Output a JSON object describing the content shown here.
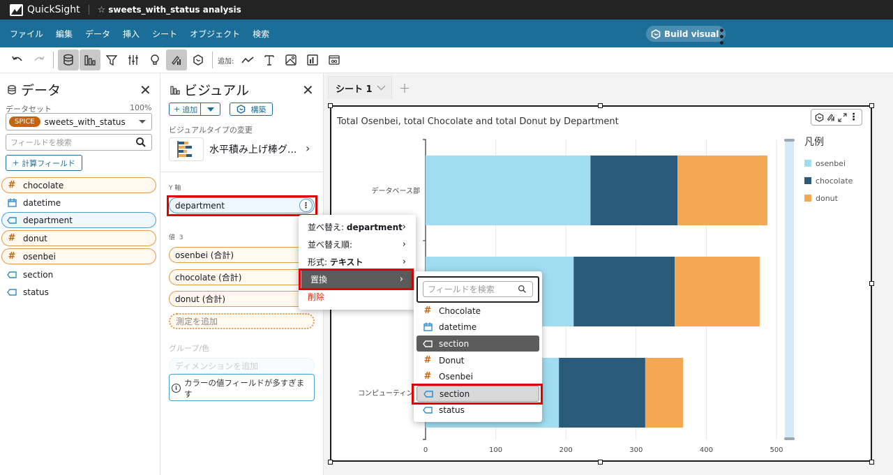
{
  "app": {
    "brand": "QuickSight",
    "analysis_title": "sweets_with_status analysis"
  },
  "menubar": {
    "items": [
      "ファイル",
      "編集",
      "データ",
      "挿入",
      "シート",
      "オブジェクト",
      "検索"
    ],
    "build_visual": "Build visual"
  },
  "toolbar": {
    "add_label": "追加:"
  },
  "data_panel": {
    "title": "データ",
    "dataset_label": "データセット",
    "dataset_percent": "100%",
    "spice_badge": "SPICE",
    "dataset_name": "sweets_with_status",
    "search_placeholder": "フィールドを検索",
    "calc_field_button": "計算フィールド",
    "fields": [
      {
        "name": "chocolate",
        "type": "measure"
      },
      {
        "name": "datetime",
        "type": "date"
      },
      {
        "name": "department",
        "type": "dimension",
        "selected": true
      },
      {
        "name": "donut",
        "type": "measure"
      },
      {
        "name": "osenbei",
        "type": "measure"
      },
      {
        "name": "section",
        "type": "dimension"
      },
      {
        "name": "status",
        "type": "dimension"
      }
    ]
  },
  "visual_panel": {
    "title": "ビジュアル",
    "add_button": "追加",
    "build_button": "構築",
    "change_type_label": "ビジュアルタイプの変更",
    "visual_type": "水平積み上げ棒グ...",
    "y_axis_label": "Y 軸",
    "y_axis_field": "department",
    "values_label": "値",
    "values_count": "3",
    "values": [
      "osenbei (合計)",
      "chocolate (合計)",
      "donut (合計)"
    ],
    "add_measure": "測定を追加",
    "group_label": "グループ/色",
    "add_dimension": "ディメンションを追加",
    "warning": "カラーの値フィールドが多すぎます"
  },
  "sheet_tabs": {
    "active": "シート 1"
  },
  "context_menu": {
    "items": [
      {
        "label": "並べ替え: ",
        "bold": "department",
        "submenu": true
      },
      {
        "label": "並べ替え順:",
        "bold": "",
        "submenu": true
      },
      {
        "label": "形式: ",
        "bold": "テキスト",
        "submenu": true
      },
      {
        "label": "置換",
        "bold": "",
        "submenu": true,
        "highlighted": true
      },
      {
        "label": "削除",
        "bold": "",
        "submenu": false,
        "danger": true
      }
    ]
  },
  "replace_submenu": {
    "search_placeholder": "フィールドを検索",
    "items": [
      {
        "name": "Chocolate",
        "type": "measure"
      },
      {
        "name": "datetime",
        "type": "date"
      },
      {
        "name": "section",
        "type": "dimension",
        "state": "current"
      },
      {
        "name": "Donut",
        "type": "measure"
      },
      {
        "name": "Osenbei",
        "type": "measure"
      },
      {
        "name": "section",
        "type": "dimension",
        "state": "hover"
      },
      {
        "name": "status",
        "type": "dimension"
      }
    ]
  },
  "colors": {
    "osenbei": "#a0ddf0",
    "chocolate": "#2a5b7a",
    "donut": "#f4a853",
    "accent": "#1b6e98",
    "spice": "#c5640b"
  },
  "chart_data": {
    "type": "bar",
    "orientation": "horizontal",
    "stacked": true,
    "title": "Total Osenbei, total Chocolate and total Donut by Department",
    "categories": [
      "データベース部",
      "",
      "コンピューティン..."
    ],
    "series": [
      {
        "name": "osenbei",
        "values": [
          235,
          211,
          190
        ]
      },
      {
        "name": "chocolate",
        "values": [
          124,
          144,
          123
        ]
      },
      {
        "name": "donut",
        "values": [
          128,
          121,
          54
        ]
      }
    ],
    "xlim": [
      0,
      520
    ],
    "xticks": [
      0,
      100,
      200,
      300,
      400,
      500
    ],
    "legend_title": "凡例",
    "legend_position": "right",
    "grid": true
  }
}
